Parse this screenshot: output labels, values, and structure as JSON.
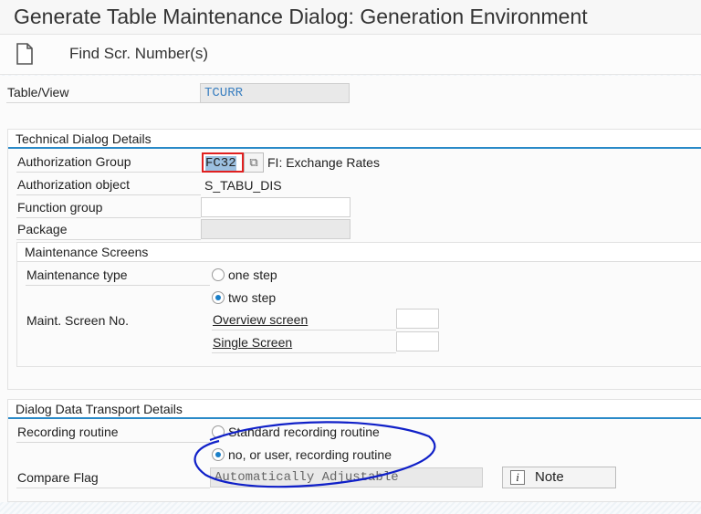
{
  "title": "Generate Table Maintenance Dialog: Generation Environment",
  "toolbar": {
    "find_label": "Find Scr. Number(s)"
  },
  "table_view": {
    "label": "Table/View",
    "value": "TCURR"
  },
  "technical": {
    "header": "Technical Dialog Details",
    "auth_group_label": "Authorization Group",
    "auth_group_value": "FC32",
    "auth_group_desc": "FI: Exchange Rates",
    "auth_object_label": "Authorization object",
    "auth_object_value": "S_TABU_DIS",
    "function_group_label": "Function group",
    "function_group_value": "",
    "package_label": "Package",
    "package_value": ""
  },
  "screens": {
    "header": "Maintenance Screens",
    "type_label": "Maintenance type",
    "one_step": "one step",
    "two_step": "two step",
    "selected": "two step",
    "screen_no_label": "Maint. Screen No.",
    "overview_label": "Overview screen",
    "overview_value": "",
    "single_label": "Single Screen",
    "single_value": ""
  },
  "transport": {
    "header": "Dialog Data Transport Details",
    "recording_label": "Recording routine",
    "standard": "Standard recording routine",
    "user": "no, or user, recording routine",
    "selected": "no, or user, recording routine",
    "compare_label": "Compare Flag",
    "compare_value": "Automatically Adjustable",
    "note_label": "Note"
  },
  "colors": {
    "accent": "#2a8ac8",
    "annotation": "#1020c8"
  }
}
